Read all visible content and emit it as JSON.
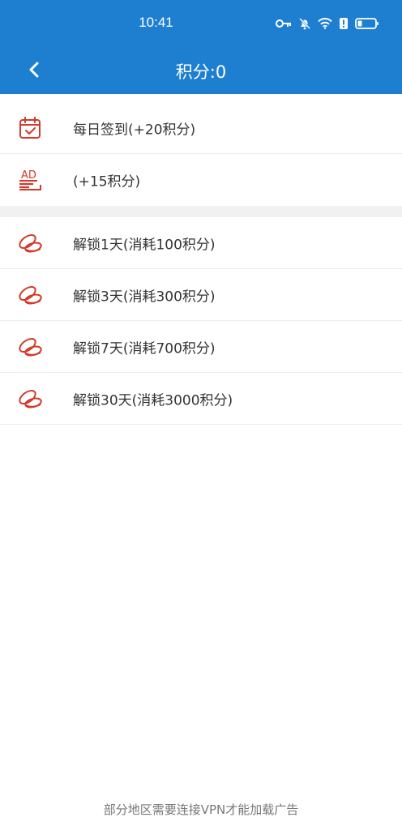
{
  "status_bar": {
    "time": "10:41",
    "icons": [
      "key-icon",
      "bell-off-icon",
      "wifi-icon",
      "alert-icon",
      "battery-icon"
    ]
  },
  "header": {
    "title": "积分:0",
    "back_icon": "chevron-left-icon",
    "background_color": "#1e7fd1"
  },
  "earn_items": [
    {
      "label": "每日签到(+20积分)",
      "icon": "calendar-check-icon"
    },
    {
      "label": "(+15积分)",
      "icon": "ad-icon"
    }
  ],
  "unlock_items": [
    {
      "label": "解锁1天(消耗100积分)",
      "icon": "coins-icon"
    },
    {
      "label": "解锁3天(消耗300积分)",
      "icon": "coins-icon"
    },
    {
      "label": "解锁7天(消耗700积分)",
      "icon": "coins-icon"
    },
    {
      "label": "解锁30天(消耗3000积分)",
      "icon": "coins-icon"
    }
  ],
  "footer": {
    "note": "部分地区需要连接VPN才能加载广告"
  },
  "colors": {
    "accent": "#1e7fd1",
    "icon_red": "#d23a2a"
  }
}
